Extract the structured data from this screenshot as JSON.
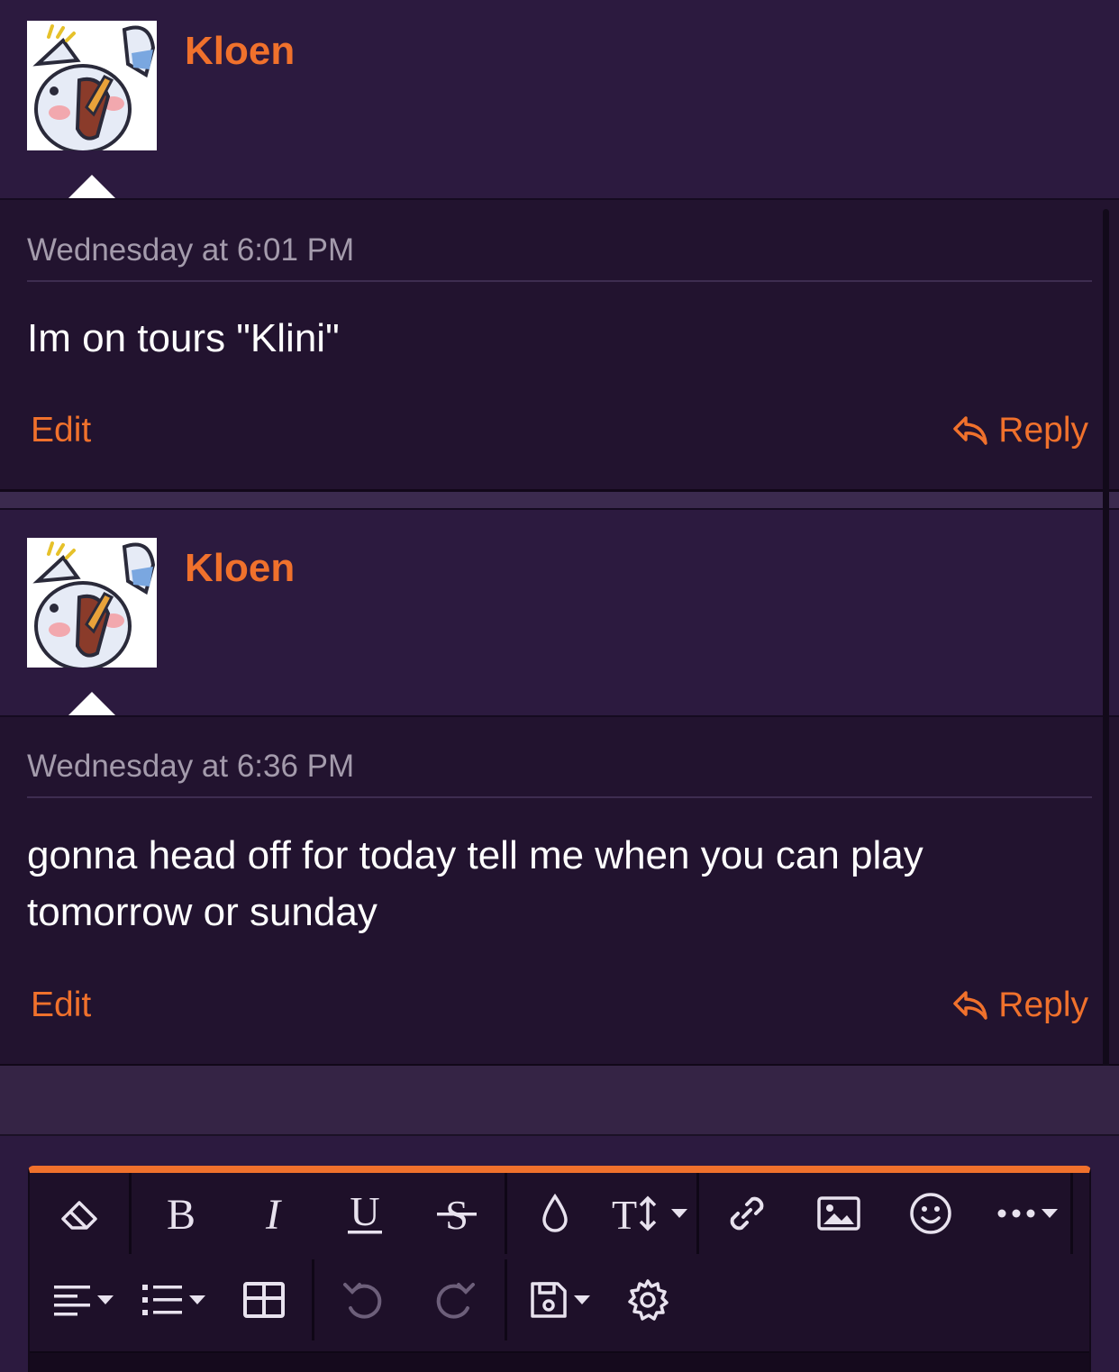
{
  "posts": [
    {
      "username": "Kloen",
      "timestamp": "Wednesday at 6:01 PM",
      "message": "Im on tours \"Klini\"",
      "edit_label": "Edit",
      "reply_label": "Reply"
    },
    {
      "username": "Kloen",
      "timestamp": "Wednesday at 6:36 PM",
      "message": "gonna head off for today tell me when you can play tomorrow or sunday",
      "edit_label": "Edit",
      "reply_label": "Reply"
    }
  ],
  "editor": {
    "toolbar_row1": [
      "eraser-icon",
      "bold-icon",
      "italic-icon",
      "underline-icon",
      "strikethrough-icon",
      "text-color-icon",
      "font-size-icon",
      "link-icon",
      "image-icon",
      "emoji-icon",
      "more-icon"
    ],
    "toolbar_row2": [
      "align-icon",
      "list-icon",
      "table-icon",
      "undo-icon",
      "redo-icon",
      "save-draft-icon",
      "settings-icon"
    ]
  },
  "colors": {
    "accent": "#f0712c",
    "background": "#2c1a3f",
    "post_body": "#22132f",
    "muted_text": "#a49bac"
  }
}
